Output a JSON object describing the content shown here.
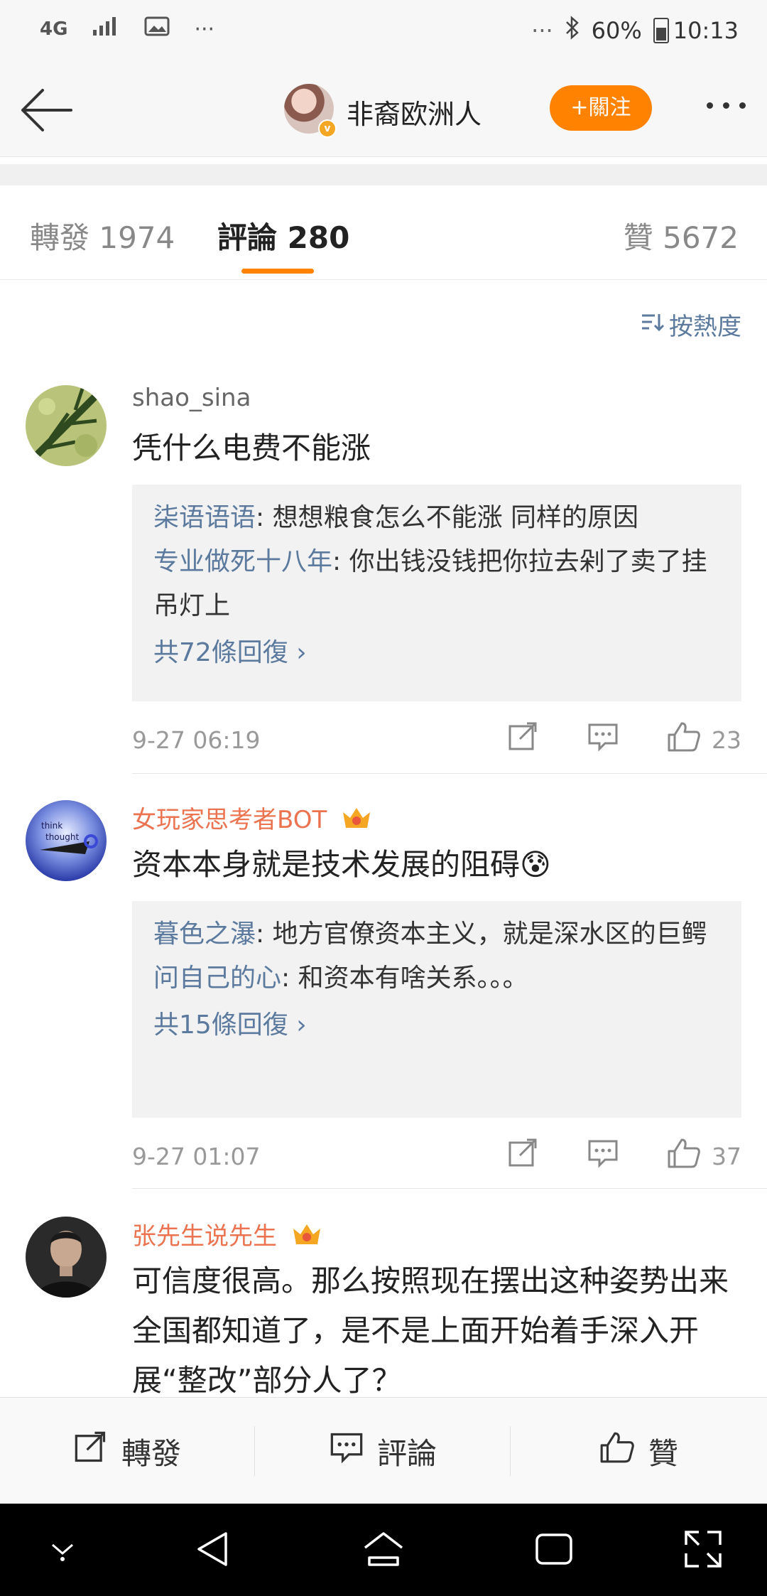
{
  "status_bar": {
    "network": "4G",
    "more": "···",
    "right_more": "···",
    "battery": "60%",
    "time": "10:13"
  },
  "nav": {
    "user_name": "非裔欧洲人",
    "follow_label": "+關注"
  },
  "tabs": [
    {
      "label": "轉發 1974"
    },
    {
      "label": "評論 280"
    },
    {
      "label": "贊 5672"
    }
  ],
  "sort_label": "按熱度",
  "comments": [
    {
      "user": "shao_sina",
      "text": "凭什么电费不能涨",
      "replies": [
        {
          "name": "柒语语语",
          "text": ": 想想粮食怎么不能涨 同样的原因"
        },
        {
          "name": "专业做死十八年",
          "text": ": 你出钱没钱把你拉去剁了卖了挂吊灯上"
        }
      ],
      "more_replies": "共72條回復 ›",
      "time": "9-27 06:19",
      "likes": "23"
    },
    {
      "user": "女玩家思考者BOT",
      "text": "资本本身就是技术发展的阻碍😰",
      "replies": [
        {
          "name": "暮色之瀑",
          "text": ": 地方官僚资本主义，就是深水区的巨鳄"
        },
        {
          "name": "问自己的心",
          "text": ": 和资本有啥关系。。。"
        }
      ],
      "more_replies": "共15條回復 ›",
      "time": "9-27 01:07",
      "likes": "37"
    },
    {
      "user": "张先生说先生",
      "text": "可信度很高。那么按照现在摆出这种姿势出来全国都知道了，是不是上面开始着手深入开展“整改”部分人了？"
    }
  ],
  "bottom_bar": {
    "repost": "轉發",
    "comment": "評論",
    "like": "贊"
  },
  "colors": {
    "accent_orange": "#ff8200",
    "link_blue": "#5b7a9e",
    "vip_name": "#eb7350"
  }
}
